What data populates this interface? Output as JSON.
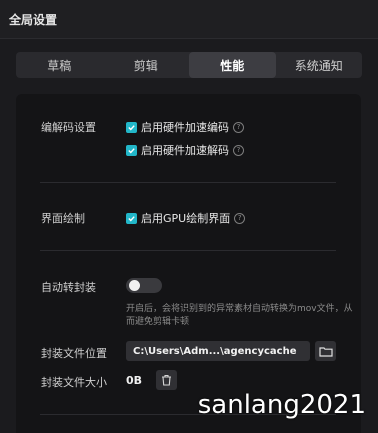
{
  "window": {
    "title": "全局设置"
  },
  "tabs": [
    {
      "label": "草稿",
      "active": false
    },
    {
      "label": "剪辑",
      "active": false
    },
    {
      "label": "性能",
      "active": true
    },
    {
      "label": "系统通知",
      "active": false
    }
  ],
  "codec": {
    "label": "编解码设置",
    "hw_encode": {
      "label": "启用硬件加速编码",
      "checked": true
    },
    "hw_decode": {
      "label": "启用硬件加速解码",
      "checked": true
    }
  },
  "render": {
    "label": "界面绘制",
    "gpu": {
      "label": "启用GPU绘制界面",
      "checked": true
    }
  },
  "auto_wrap": {
    "label": "自动转封装",
    "enabled": false,
    "description": "开启后，会将识别到的异常素材自动转换为mov文件，从而避免剪辑卡顿"
  },
  "wrap_location": {
    "label": "封装文件位置",
    "value": "C:\\Users\\Adm...\\agencycache"
  },
  "wrap_size": {
    "label": "封装文件大小",
    "value": "0B"
  },
  "watermark": "sanlang2021",
  "colors": {
    "accent": "#22b7c9",
    "background": "#1b1b1e",
    "panel": "#141416"
  }
}
